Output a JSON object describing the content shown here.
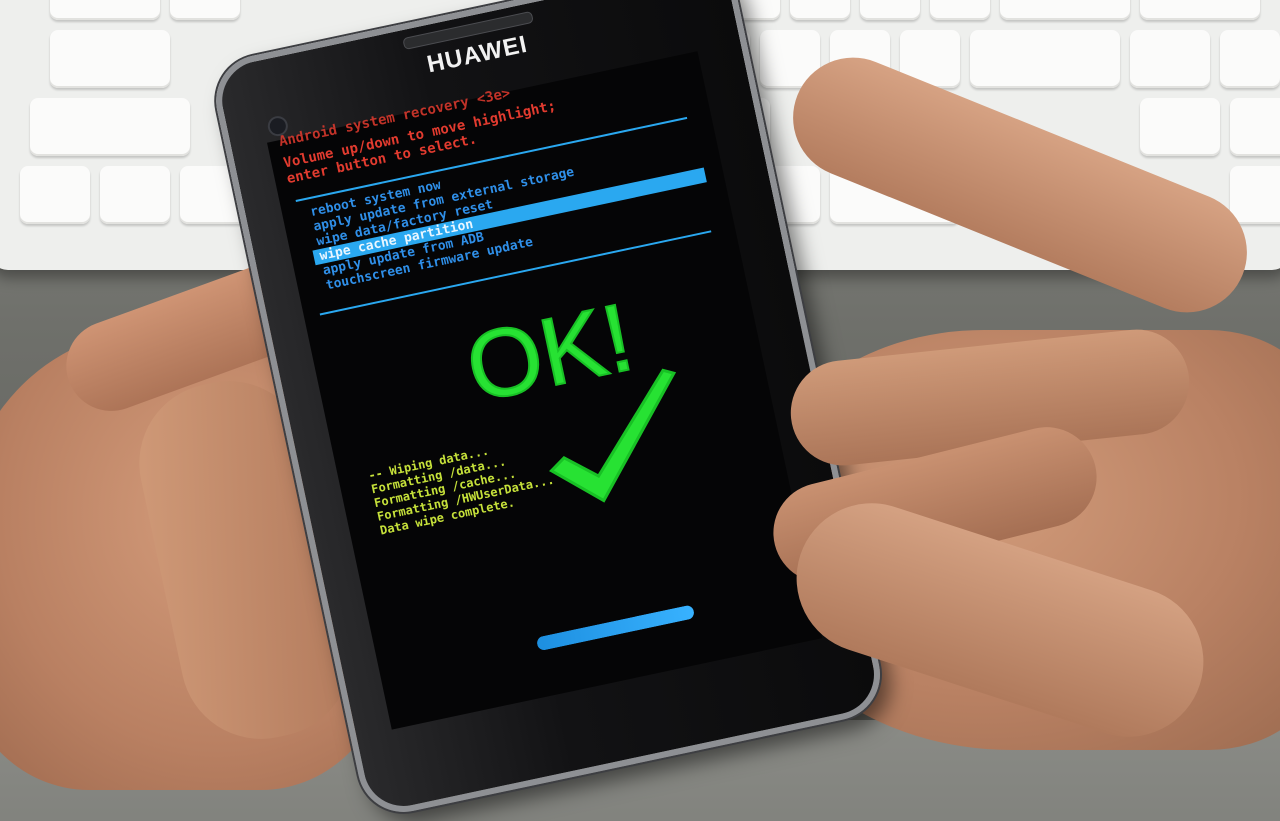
{
  "phone": {
    "brand": "HUAWEI",
    "recovery_title": "Android system recovery <3e>",
    "instructions": [
      "Volume up/down to move highlight;",
      "enter button to select."
    ],
    "menu": [
      {
        "label": "reboot system now",
        "selected": false
      },
      {
        "label": "apply update from external storage",
        "selected": false
      },
      {
        "label": "wipe data/factory reset",
        "selected": false
      },
      {
        "label": "wipe cache partition",
        "selected": true
      },
      {
        "label": "apply update from ADB",
        "selected": false
      },
      {
        "label": "touchscreen firmware update",
        "selected": false
      }
    ],
    "overlay_text": "OK!",
    "log": [
      "-- Wiping data...",
      "Formatting /data...",
      "Formatting /cache...",
      "Formatting /HWUserData...",
      "Data wipe complete."
    ],
    "progress": 1.0
  },
  "colors": {
    "recovery_text": "#e23b2f",
    "menu_text": "#2f8fe8",
    "highlight": "#2aa8f0",
    "ok_green": "#27e233",
    "log_text": "#c6e13a"
  }
}
